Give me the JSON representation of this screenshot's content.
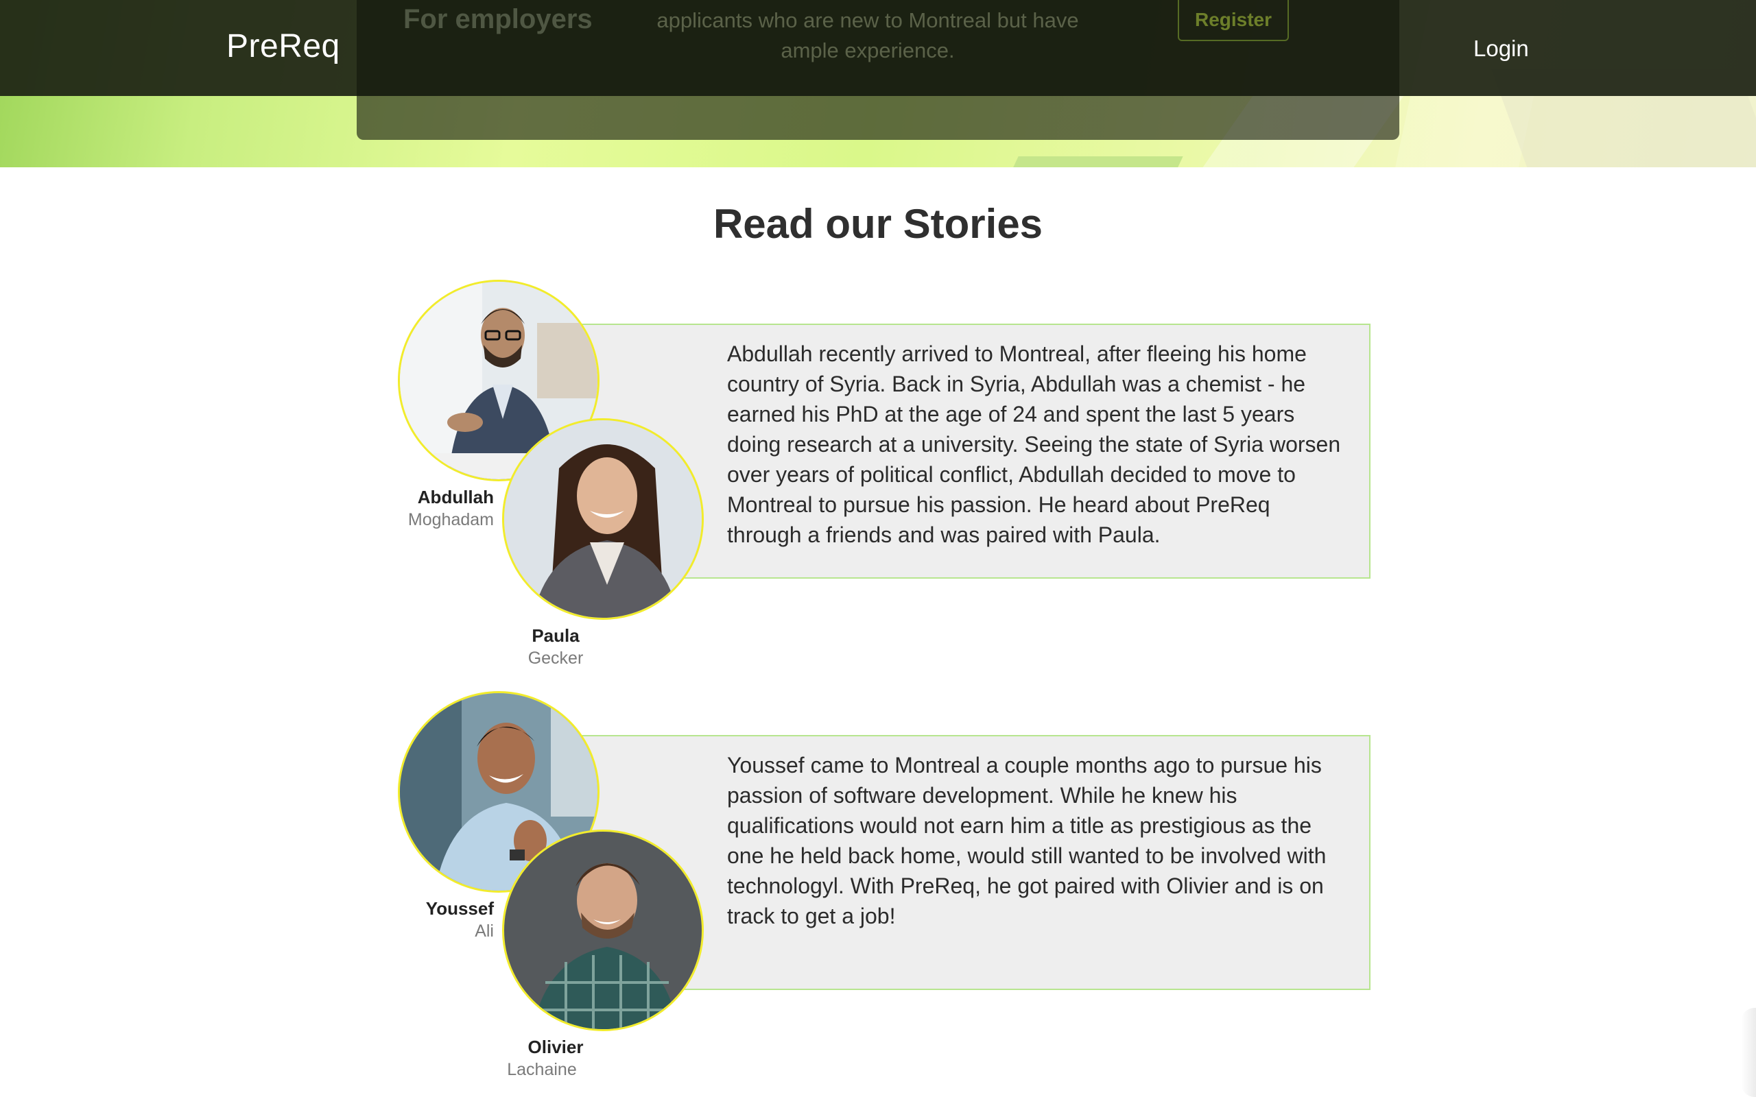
{
  "navbar": {
    "brand": "PreReq",
    "login_label": "Login"
  },
  "hero_card": {
    "heading": "For employers",
    "text": "applicants who are new to Montreal but have ample experience.",
    "register_label": "Register"
  },
  "stories": {
    "title": "Read our Stories",
    "items": [
      {
        "newcomer": {
          "first": "Abdullah",
          "last": "Moghadam"
        },
        "mentor": {
          "first": "Paula",
          "last": "Gecker"
        },
        "text": "Abdullah recently arrived to Montreal, after fleeing his home country of Syria. Back in Syria, Abdullah was a chemist - he earned his PhD at the age of 24 and spent the last 5 years doing research at a university. Seeing the state of Syria worsen over years of political conflict, Abdullah decided to move to Montreal to pursue his passion. He heard about PreReq through a friends and was paired with Paula."
      },
      {
        "newcomer": {
          "first": "Youssef",
          "last": "Ali"
        },
        "mentor": {
          "first": "Olivier",
          "last": "Lachaine"
        },
        "text": "Youssef came to Montreal a couple months ago to pursue his passion of software development. While he knew his qualifications would not earn him a title as prestigious as the one he held back home, would still wanted to be involved with technologyl. With PreReq, he got paired with Olivier and is on track to get a job!"
      }
    ]
  },
  "colors": {
    "navbar_bg": "#1c2214",
    "hero_green": "#c8ee80",
    "avatar_ring": "#f2ec2b",
    "story_border": "#b7e58f",
    "story_bg": "#eeeeee"
  }
}
